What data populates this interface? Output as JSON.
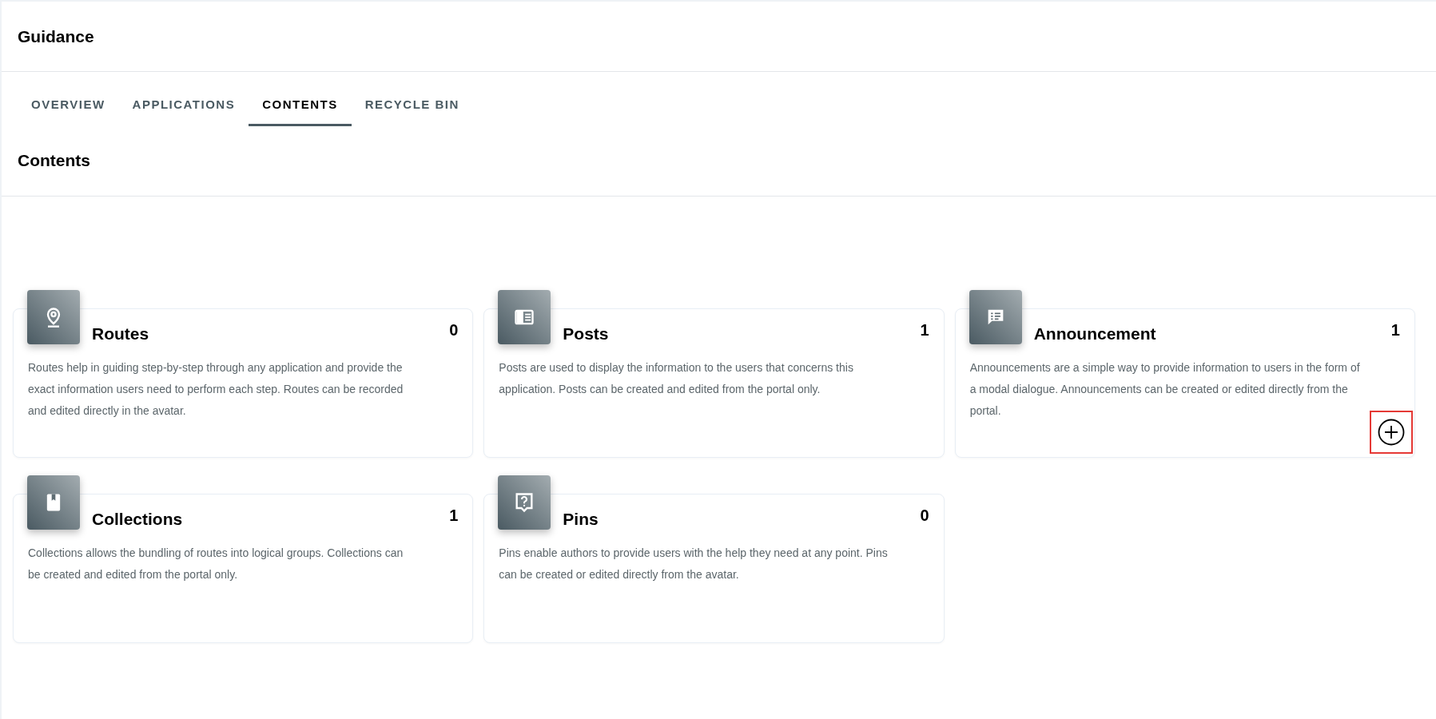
{
  "page_title": "Guidance",
  "tabs": [
    {
      "label": "OVERVIEW",
      "selected": false
    },
    {
      "label": "APPLICATIONS",
      "selected": false
    },
    {
      "label": "CONTENTS",
      "selected": true
    },
    {
      "label": "RECYCLE BIN",
      "selected": false
    }
  ],
  "section_title": "Contents",
  "cards": [
    {
      "kind": "location",
      "title": "Routes",
      "count": "0",
      "description": "Routes help in guiding step-by-step through any application and provide the exact information users need to perform each step. Routes can be recorded and edited directly in the avatar.",
      "add_button": false
    },
    {
      "kind": "post",
      "title": "Posts",
      "count": "1",
      "description": "Posts are used to display the information to the users that concerns this application. Posts can be created and edited from the portal only.",
      "add_button": false
    },
    {
      "kind": "announcement",
      "title": "Announcement",
      "count": "1",
      "description": "Announcements are a simple way to provide information to users in the form of a modal dialogue. Announcements can be created or edited directly from the portal.",
      "add_button": true
    },
    {
      "kind": "collection",
      "title": "Collections",
      "count": "1",
      "description": "Collections allows the bundling of routes into logical groups. Collections can be created and edited from the portal only.",
      "add_button": false
    },
    {
      "kind": "pin",
      "title": "Pins",
      "count": "0",
      "description": "Pins enable authors to provide users with the help they need at any point. Pins can be created or edited directly from the avatar.",
      "add_button": false
    }
  ]
}
